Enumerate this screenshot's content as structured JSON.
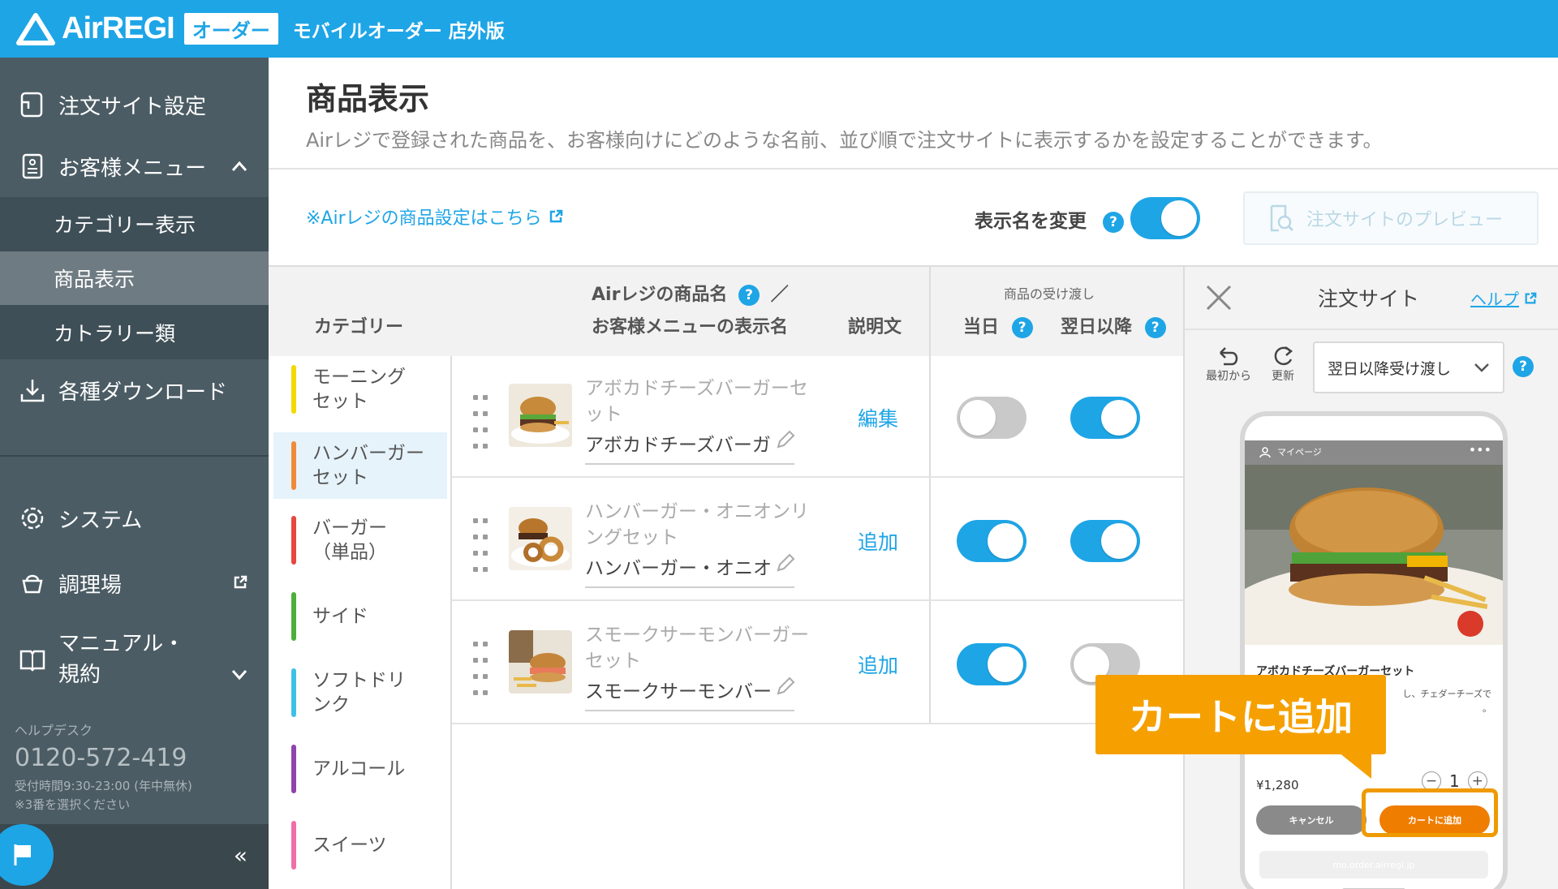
{
  "header": {
    "logo_text": "AirREGI",
    "logo_badge": "オーダー",
    "subtitle": "モバイルオーダー 店外版",
    "brand_color": "#1ea5e6"
  },
  "sidebar": {
    "items": [
      {
        "label": "注文サイト設定",
        "icon": "document-edit-icon"
      },
      {
        "label": "お客様メニュー",
        "icon": "menu-book-icon",
        "expanded": true
      },
      {
        "label": "各種ダウンロード",
        "icon": "download-icon"
      },
      {
        "label": "システム",
        "icon": "gear-icon"
      },
      {
        "label": "調理場",
        "icon": "cooking-pot-icon"
      },
      {
        "label": "マニュアル・\n規約",
        "icon": "manual-book-icon"
      }
    ],
    "sub_items": [
      {
        "label": "カテゴリー表示",
        "active": false
      },
      {
        "label": "商品表示",
        "active": true
      },
      {
        "label": "カトラリー類",
        "active": false
      }
    ],
    "help": {
      "title": "ヘルプデスク",
      "phone": "0120-572-419",
      "hours": "受付時間9:30-23:00 (年中無休)",
      "note": "※3番を選択ください"
    }
  },
  "main": {
    "title": "商品表示",
    "description": "Airレジで登録された商品を、お客様向けにどのような名前、並び順で注文サイトに表示するかを設定することができます。",
    "airregi_link": "※Airレジの商品設定はこちら",
    "rename_label": "表示名を変更",
    "rename_toggle": true,
    "preview_button": "注文サイトのプレビュー"
  },
  "table": {
    "col_category": "カテゴリー",
    "col_name_line1": "Airレジの商品名",
    "col_name_slash": "／",
    "col_name_line2": "お客様メニューの表示名",
    "col_desc": "説明文",
    "col_handover": "商品の受け渡し",
    "col_today": "当日",
    "col_nextday": "翌日以降",
    "categories": [
      {
        "label": "モーニング\nセット",
        "color": "#f5d800",
        "active": false
      },
      {
        "label": "ハンバーガー\nセット",
        "color": "#ef8a3a",
        "active": true
      },
      {
        "label": "バーガー\n（単品）",
        "color": "#e8473f",
        "active": false
      },
      {
        "label": "サイド",
        "color": "#4caf3a",
        "active": false
      },
      {
        "label": "ソフトドリ\nンク",
        "color": "#3fc0e8",
        "active": false
      },
      {
        "label": "アルコール",
        "color": "#8e44ad",
        "active": false
      },
      {
        "label": "スイーツ",
        "color": "#f06ea8",
        "active": false
      }
    ],
    "products": [
      {
        "name": "アボカドチーズバーガーセット",
        "display": "アボカドチーズバーガ",
        "action": "編集",
        "today": false,
        "nextday": true
      },
      {
        "name": "ハンバーガー・オニオンリングセット",
        "display": "ハンバーガー・オニオ",
        "action": "追加",
        "today": true,
        "nextday": true
      },
      {
        "name": "スモークサーモンバーガーセット",
        "display": "スモークサーモンバー",
        "action": "追加",
        "today": true,
        "nextday": false
      }
    ]
  },
  "panel": {
    "title": "注文サイト",
    "help": "ヘルプ",
    "tool_reset": "最初から",
    "tool_refresh": "更新",
    "select_value": "翌日以降受け渡し",
    "phone": {
      "bar_text": "マイページ",
      "item_title": "アボカドチーズバーガーセット",
      "desc": "し、チェダーチーズで\n。",
      "price": "¥1,280",
      "qty": "1",
      "cancel": "キャンセル",
      "add": "カートに追加",
      "url": "mo.order.airregi.jp"
    },
    "callout": "カートに追加",
    "accent_color": "#ef7d00"
  }
}
